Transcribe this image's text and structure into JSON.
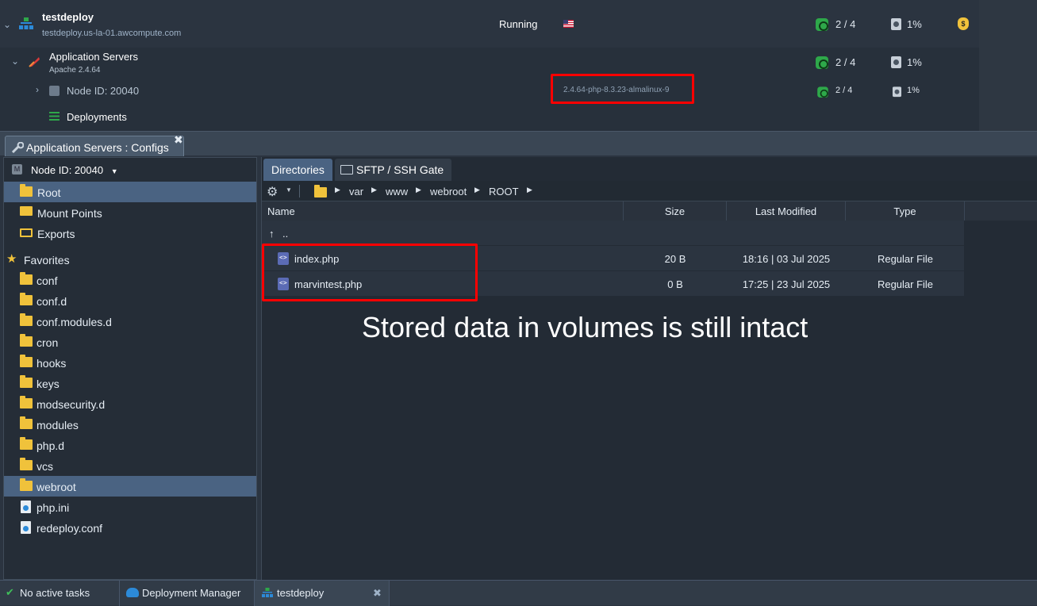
{
  "environment": {
    "name": "testdeploy",
    "domain": "testdeploy.us-la-01.awcompute.com",
    "status": "Running",
    "cloudlets": "2 / 4",
    "disk": "1%"
  },
  "group": {
    "name": "Application Servers",
    "version": "Apache 2.4.64",
    "cloudlets": "2 / 4",
    "disk": "1%"
  },
  "node": {
    "label": "Node ID: 20040",
    "tag": "2.4.64-php-8.3.23-almalinux-9",
    "cloudlets": "2 / 4",
    "disk": "1%"
  },
  "deployments_label": "Deployments",
  "config_tab_label": "Application Servers : Configs",
  "node_selector": "Node ID: 20040",
  "sidebar": {
    "top_items": [
      {
        "label": "Root",
        "icon": "folder-icon"
      },
      {
        "label": "Mount Points",
        "icon": "mount-icon"
      },
      {
        "label": "Exports",
        "icon": "exports-icon"
      }
    ],
    "favorites_label": "Favorites",
    "favorites": [
      {
        "label": "conf",
        "type": "folder"
      },
      {
        "label": "conf.d",
        "type": "folder"
      },
      {
        "label": "conf.modules.d",
        "type": "folder"
      },
      {
        "label": "cron",
        "type": "folder"
      },
      {
        "label": "hooks",
        "type": "folder"
      },
      {
        "label": "keys",
        "type": "folder"
      },
      {
        "label": "modsecurity.d",
        "type": "folder"
      },
      {
        "label": "modules",
        "type": "folder"
      },
      {
        "label": "php.d",
        "type": "folder"
      },
      {
        "label": "vcs",
        "type": "folder"
      },
      {
        "label": "webroot",
        "type": "folder"
      },
      {
        "label": "php.ini",
        "type": "file"
      },
      {
        "label": "redeploy.conf",
        "type": "file"
      }
    ]
  },
  "right_tabs": [
    "Directories",
    "SFTP / SSH Gate"
  ],
  "breadcrumb": [
    "var",
    "www",
    "webroot",
    "ROOT"
  ],
  "table": {
    "columns": [
      "Name",
      "Size",
      "Last Modified",
      "Type"
    ],
    "parent": "..",
    "rows": [
      {
        "name": "index.php",
        "size": "20 B",
        "modified": "18:16 | 03 Jul 2025",
        "type": "Regular File"
      },
      {
        "name": "marvintest.php",
        "size": "0 B",
        "modified": "17:25 | 23 Jul 2025",
        "type": "Regular File"
      }
    ]
  },
  "annotation": "Stored data in volumes is still intact",
  "statusbar": {
    "tasks": "No active tasks",
    "deployment_manager": "Deployment Manager",
    "env_tab": "testdeploy"
  },
  "colors": {
    "accent": "#4a6382",
    "highlight_box": "#ff0000",
    "folder": "#f0c23b"
  }
}
